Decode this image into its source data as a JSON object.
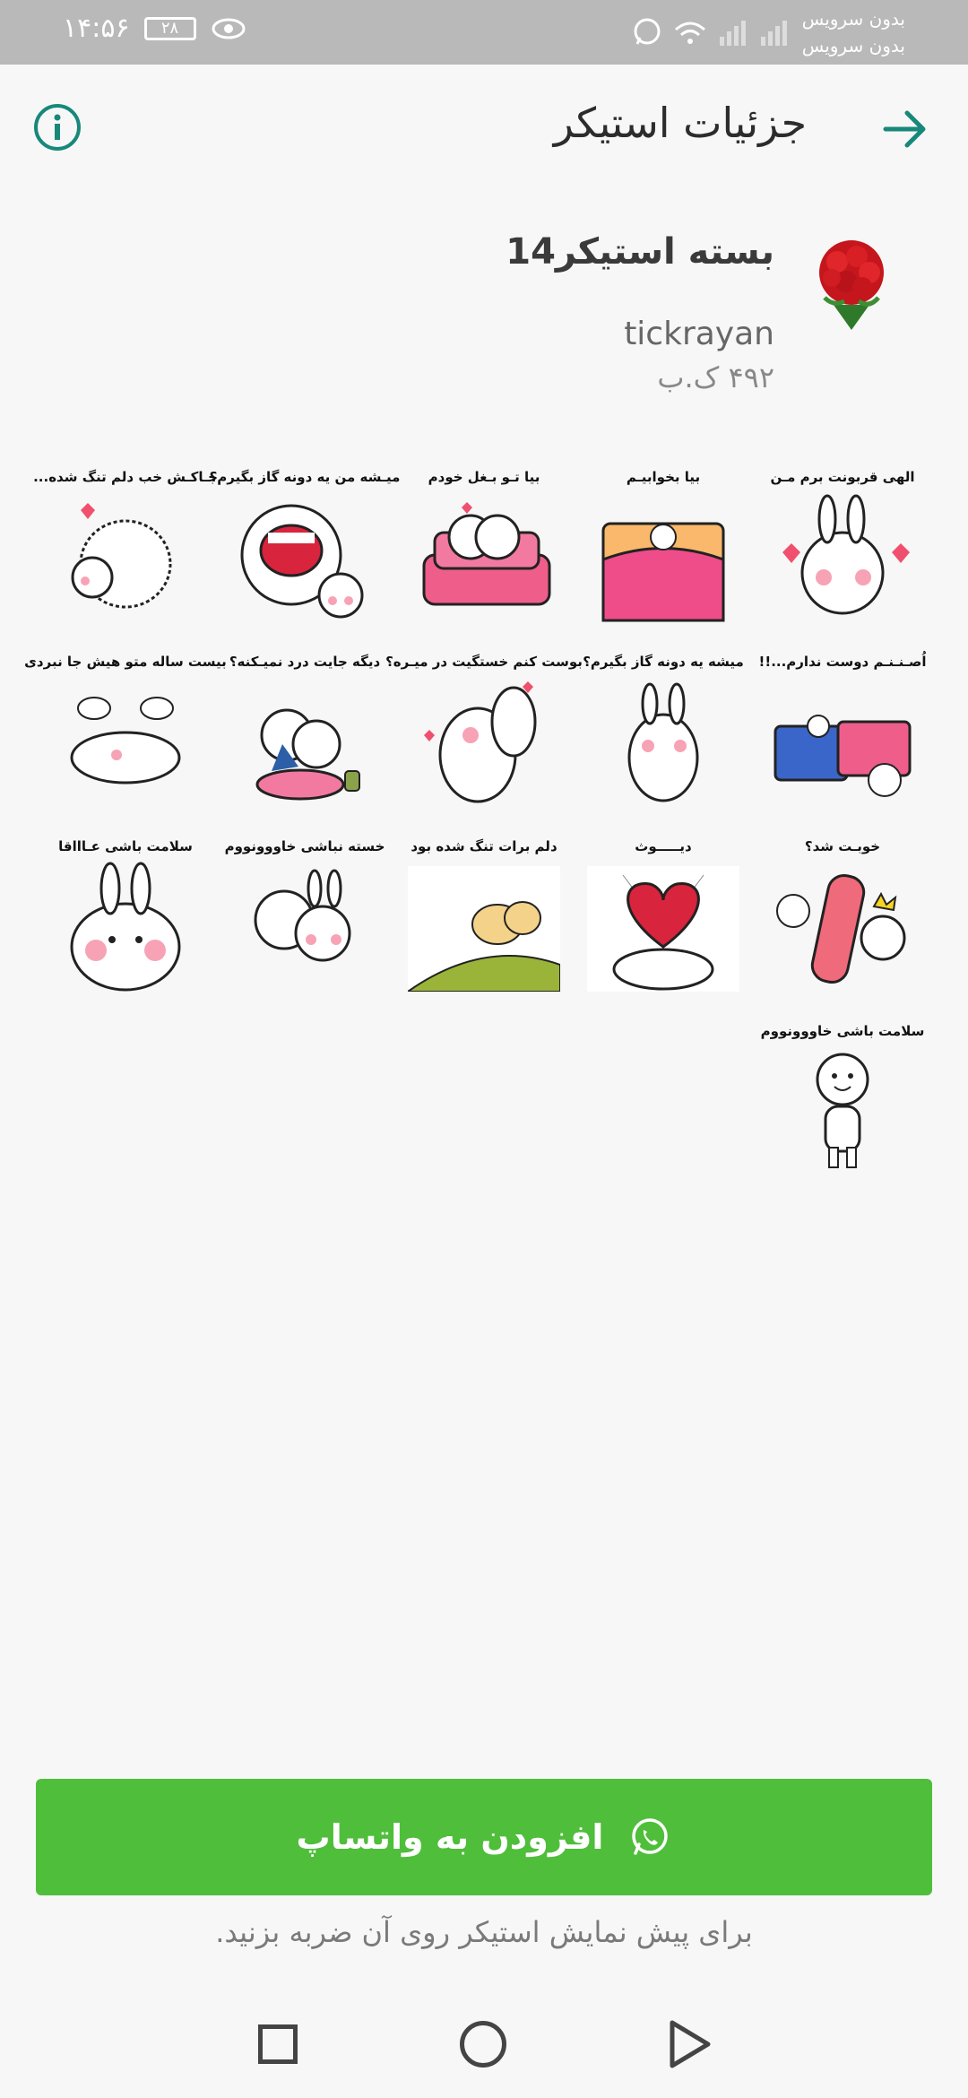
{
  "status_bar": {
    "time": "۱۴:۵۶",
    "battery": "۲۸",
    "carrier_1": "بدون سرویس",
    "carrier_2": "بدون سرویس"
  },
  "app_bar": {
    "title": "جزئیات استیکر",
    "back_icon": "arrow-right-icon",
    "info_icon": "info-icon",
    "accent_color": "#17887a"
  },
  "pack": {
    "name": "بسته استیکر14",
    "author": "tickrayan",
    "size": "۴۹۲ ک.ب"
  },
  "stickers": [
    {
      "caption": "الهی قربونت برم مـن",
      "art": "bunny-hearts"
    },
    {
      "caption": "بیا بخوابیـم",
      "art": "bunny-bed"
    },
    {
      "caption": "بیا تـو بـغل خودم",
      "art": "bunny-sofa"
    },
    {
      "caption": "میـشه من یه دونه گاز بگیرم؟",
      "art": "mouth-bite"
    },
    {
      "caption": "جـاکـش خب دلم تنگ شده...",
      "art": "hug-pillow"
    },
    {
      "caption": "اُصـنـنـم دوست ندارم...!!",
      "art": "beds"
    },
    {
      "caption": "میشه یه دونه گاز بگیرم؟",
      "art": "bunny-shy"
    },
    {
      "caption": "بوست کنم خستگیت در میـره؟",
      "art": "bunny-kiss"
    },
    {
      "caption": "دیگه جایت درد نمیـکنه؟",
      "art": "bunny-cushion"
    },
    {
      "caption": "بیست ساله متو هیش جا نبردی",
      "art": "bunny-lying"
    },
    {
      "caption": "خوبـت شد؟",
      "art": "slap"
    },
    {
      "caption": "دیـــــوث",
      "art": "heart-big"
    },
    {
      "caption": "دلم برات تنگ شده بود",
      "art": "bunny-hill"
    },
    {
      "caption": "خسته نباشی خاووونووم",
      "art": "hug-two"
    },
    {
      "caption": "سلامت باشی عـاااقا",
      "art": "bunny-face"
    },
    {
      "caption": "سلامت باشی خاووونووم",
      "art": "guy-stand"
    }
  ],
  "actions": {
    "add_label": "افزودن به واتساپ",
    "add_color": "#4fbe3a",
    "hint": "برای پیش نمایش استیکر روی آن ضربه بزنید."
  },
  "nav": {
    "recents_icon": "square-icon",
    "home_icon": "circle-icon",
    "back_icon": "triangle-back-icon"
  }
}
